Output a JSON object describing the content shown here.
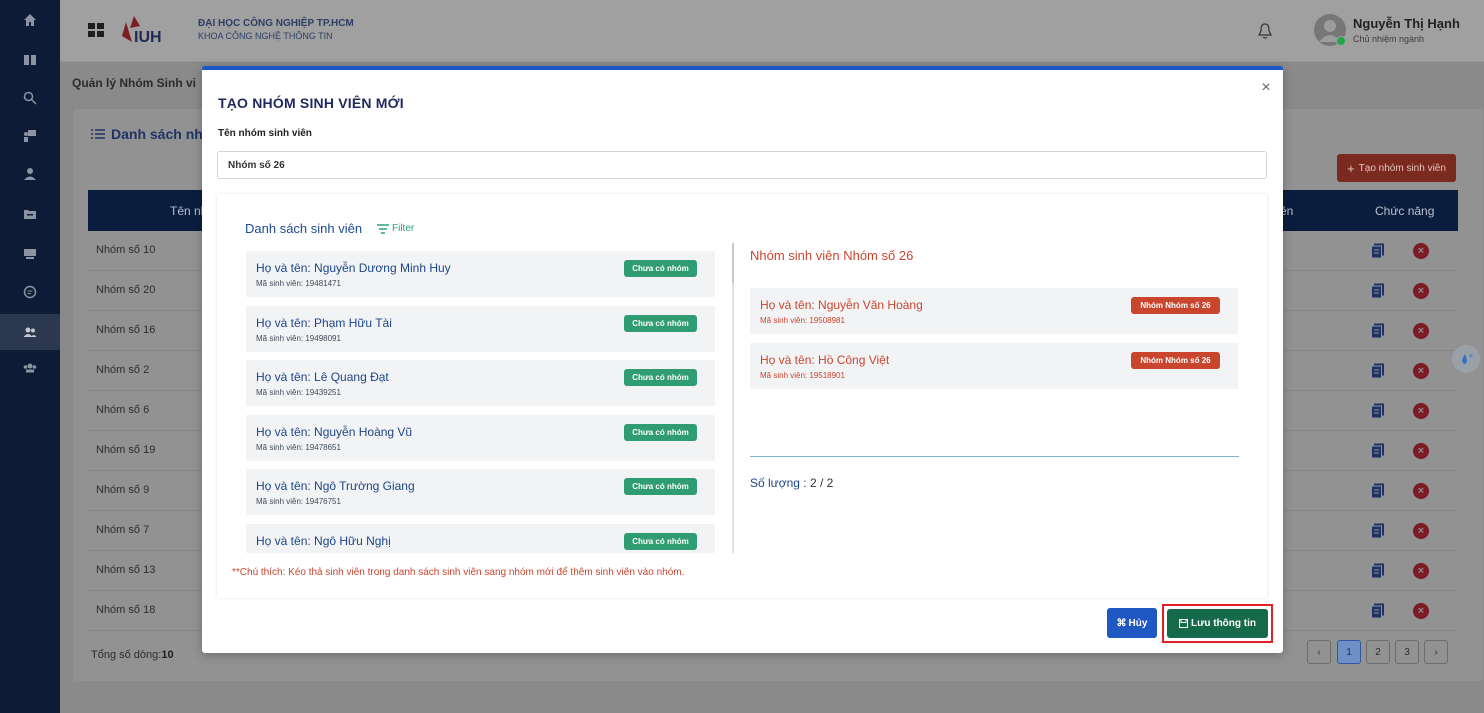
{
  "header": {
    "university": "ĐẠI HỌC CÔNG NGHIỆP TP.HCM",
    "faculty": "KHOA CÔNG NGHỆ THÔNG TIN",
    "user_name": "Nguyễn Thị Hạnh",
    "user_role": "Chủ nhiệm ngành"
  },
  "sidebar": {
    "icons": [
      "home-icon",
      "book-icon",
      "search-icon",
      "presentation-icon",
      "student-icon",
      "folder-icon",
      "monitor-icon",
      "chat-icon",
      "group-icon",
      "users-icon"
    ],
    "active_index": 8
  },
  "page": {
    "breadcrumb": "Quản lý Nhóm Sinh vi",
    "card_title": "Danh sách nhó",
    "create_button": "Tạo nhóm sinh viên",
    "col_name": "Tên nh",
    "col_members": "ên",
    "col_actions": "Chức năng",
    "rows": [
      "Nhóm số 10",
      "Nhóm số 20",
      "Nhóm số 16",
      "Nhóm số 2",
      "Nhóm số 6",
      "Nhóm số 19",
      "Nhóm số 9",
      "Nhóm số 7",
      "Nhóm số 13",
      "Nhóm số 18"
    ],
    "total_label": "Tổng số dòng:",
    "total_value": "10",
    "pages": [
      "1",
      "2",
      "3"
    ],
    "current_page": "1"
  },
  "modal": {
    "title": "TẠO NHÓM SINH VIÊN MỚI",
    "group_name_label": "Tên nhóm sinh viên",
    "group_name_value": "Nhóm số 26",
    "student_list_title": "Danh sách sinh viên",
    "filter_label": "Filter",
    "students": [
      {
        "name": "Họ và tên: Nguyễn Dương Minh Huy",
        "id": "Mã sinh viên: 19481471",
        "status": "Chưa có nhóm"
      },
      {
        "name": "Họ và tên: Phạm Hữu Tài",
        "id": "Mã sinh viên: 19498091",
        "status": "Chưa có nhóm"
      },
      {
        "name": "Họ và tên: Lê Quang Đạt",
        "id": "Mã sinh viên: 19439251",
        "status": "Chưa có nhóm"
      },
      {
        "name": "Họ và tên: Nguyễn Hoàng Vũ",
        "id": "Mã sinh viên: 19478651",
        "status": "Chưa có nhóm"
      },
      {
        "name": "Họ và tên: Ngô Trường Giang",
        "id": "Mã sinh viên: 19476751",
        "status": "Chưa có nhóm"
      },
      {
        "name": "Họ và tên: Ngô Hữu Nghị",
        "id": "",
        "status": "Chưa có nhóm"
      }
    ],
    "group_members_title": "Nhóm sinh viên Nhóm số 26",
    "members": [
      {
        "name": "Họ và tên: Nguyễn Văn Hoàng",
        "id": "Mã sinh viên: 19508981",
        "badge": "Nhóm Nhóm số 26"
      },
      {
        "name": "Họ và tên: Hồ Công Việt",
        "id": "Mã sinh viên: 19518901",
        "badge": "Nhóm Nhóm số 26"
      }
    ],
    "count_label": "Số lượng : ",
    "count_value": "2 / 2",
    "note": "**Chú thích: Kéo thả sinh viên trong danh sách sinh viên sang nhóm mới để thêm sinh viên vào nhóm.",
    "cancel_label": "Hủy",
    "save_label": "Lưu thông tin"
  },
  "colors": {
    "sidebar": "#0d1b36",
    "modal_accent": "#1c56c4",
    "green_badge": "#2f9c74",
    "red_badge": "#c9452e",
    "save_button": "#17694b",
    "highlight_outline": "#e31e24"
  }
}
